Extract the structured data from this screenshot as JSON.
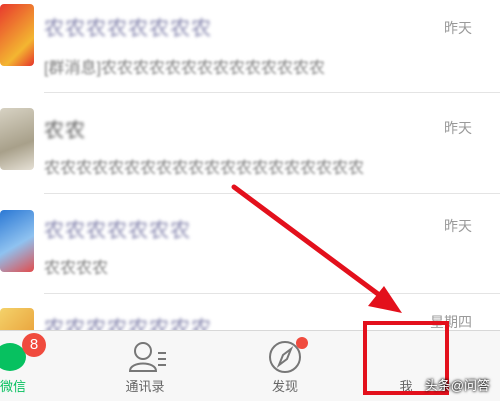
{
  "chats": [
    {
      "name": "农农农农农农农农",
      "preview": "[群消息]农农农农农农农农农农农农农农",
      "time": "昨天"
    },
    {
      "name": "农农",
      "preview": "农农农农农农农农农农农农农农农农农农农农",
      "time": "昨天"
    },
    {
      "name": "农农农农农农农",
      "preview": "农农农农",
      "time": "昨天"
    },
    {
      "name": "农农农农农农农农",
      "preview": "",
      "time": "星期四"
    }
  ],
  "tabbar": {
    "weixin": {
      "label": "微信",
      "badge": "8"
    },
    "contacts": {
      "label": "通讯录"
    },
    "discover": {
      "label": "发现"
    },
    "me": {
      "label": "我"
    }
  },
  "watermark": "头条@问答",
  "colors": {
    "highlight": "#e3101c",
    "brand_green": "#07c160",
    "badge_red": "#f04b3e"
  }
}
